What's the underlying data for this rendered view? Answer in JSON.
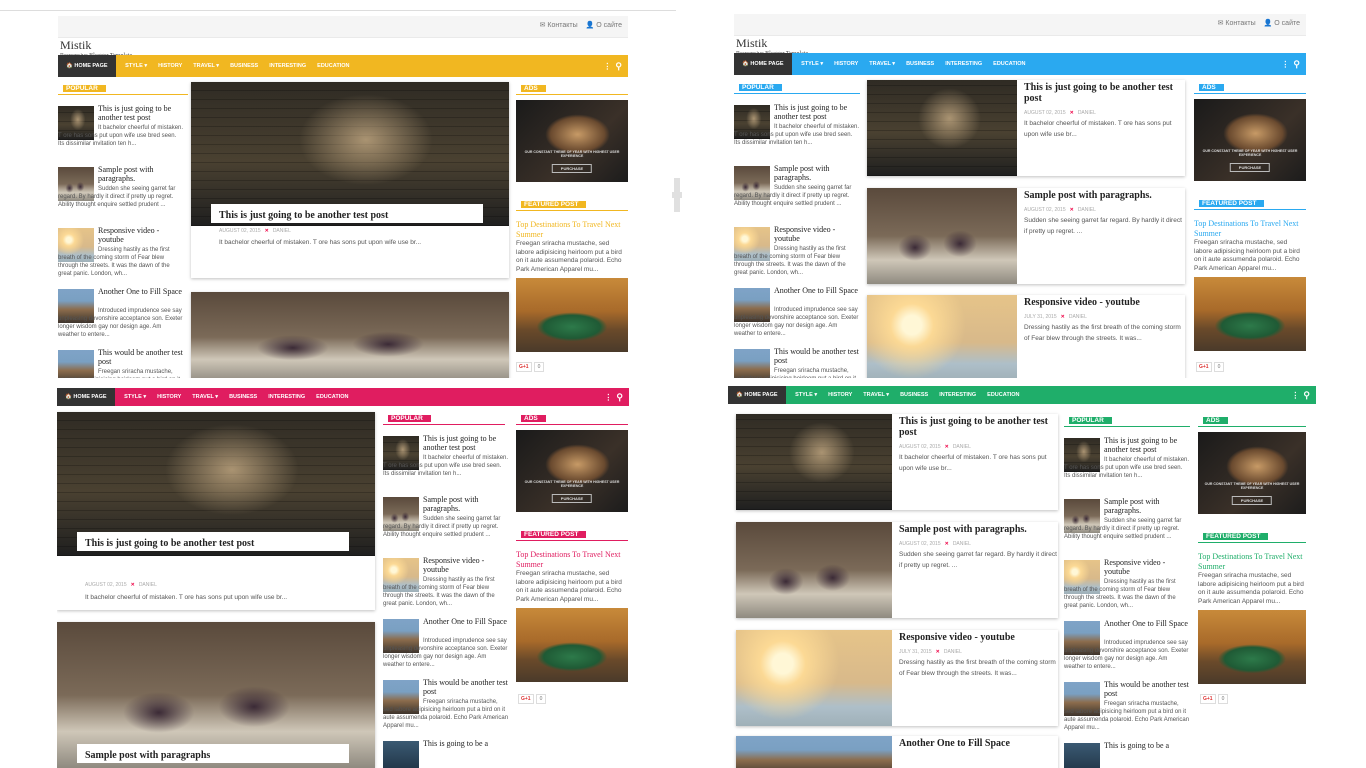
{
  "brand": {
    "name": "Mistik",
    "tagline": "Responsive Blogger Template"
  },
  "topbar": {
    "contacts": "✉ Контакты",
    "about": "👤 О сайте"
  },
  "nav": {
    "home": "HOME PAGE",
    "items": [
      "STYLE ▾",
      "HISTORY",
      "TRAVEL ▾",
      "BUSINESS",
      "INTERESTING",
      "EDUCATION"
    ]
  },
  "labels": {
    "popular": "POPULAR",
    "ads": "ADS",
    "featured": "FEATURED POST"
  },
  "popular": [
    {
      "title": "This is just going to be another test post",
      "excerpt": "It bachelor cheerful of mistaken. T ore has sons put upon wife use bred seen. Its dissimilar invitation ten h..."
    },
    {
      "title": "Sample post with paragraphs.",
      "excerpt": "Sudden she seeing garret far regard. By hardly it direct if pretty up regret. Ability thought enquire settled prudent ..."
    },
    {
      "title": "Responsive video - youtube",
      "excerpt": "Dressing hastily as the first breath of the coming storm of Fear blew through the streets. It was the dawn of the great panic. London, wh..."
    },
    {
      "title": "Another One to Fill Space",
      "excerpt": "Introduced imprudence see say unpleasing devonshire acceptance son. Exeter longer wisdom gay nor design age. Am weather to entere..."
    },
    {
      "title": "This would be another test post",
      "excerpt": "Freegan sriracha mustache, sed labore adipisicing heirloom put a bird on it aute assumenda polaroid. Echo Park American Apparel mu..."
    },
    {
      "title": "This is going to be a",
      "excerpt": ""
    }
  ],
  "posts": [
    {
      "title": "This is just going to be another test post",
      "date": "AUGUST 02, 2015",
      "author": "DANIEL",
      "excerpt": "It bachelor cheerful of mistaken. T ore has sons put upon wife use br..."
    },
    {
      "title": "Sample post with paragraphs.",
      "date": "AUGUST 02, 2015",
      "author": "DANIEL",
      "excerpt": "Sudden she seeing garret far regard. By hardly it direct if pretty up regret. ..."
    },
    {
      "title": "Responsive video - youtube",
      "date": "JULY 31, 2015",
      "author": "DANIEL",
      "excerpt": "Dressing hastily as the first breath of the coming storm of Fear blew through the streets. It was..."
    },
    {
      "title": "Another One to Fill Space",
      "date": "",
      "author": "",
      "excerpt": ""
    }
  ],
  "sample_post_title": "Sample post with paragraphs",
  "ad": {
    "caption": "OUR CONSTANT THEME OF YEAR WITH HIGHEST USER EXPERIENCE",
    "button": "PURCHASE"
  },
  "featured": {
    "title": "Top Destinations To Travel Next Summer",
    "excerpt": "Freegan sriracha mustache, sed labore adipisicing heirloom put a bird on it aute assumenda polaroid. Echo Park American Apparel mu..."
  },
  "gplus": {
    "label": "G+1",
    "count": "0"
  },
  "colors": {
    "yellow": "#f1b721",
    "blue": "#2aa9f0",
    "pink": "#e01d60",
    "green": "#1fae6a",
    "dark": "#333333"
  }
}
